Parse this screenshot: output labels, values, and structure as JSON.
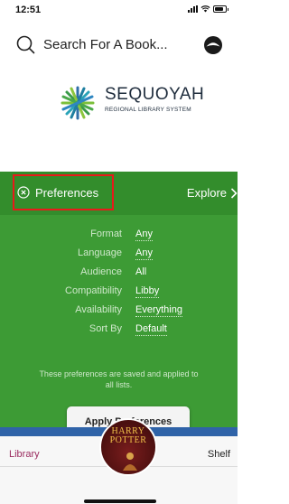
{
  "status_bar": {
    "time": "12:51"
  },
  "search": {
    "label": "Search For A Book..."
  },
  "logo": {
    "title": "SEQUOYAH",
    "subtitle": "REGIONAL LIBRARY SYSTEM"
  },
  "preferences": {
    "button_label": "Preferences",
    "explore_label": "Explore",
    "rows": [
      {
        "label": "Format",
        "value": "Any"
      },
      {
        "label": "Language",
        "value": "Any"
      },
      {
        "label": "Audience",
        "value": "All"
      },
      {
        "label": "Compatibility",
        "value": "Libby"
      },
      {
        "label": "Availability",
        "value": "Everything"
      },
      {
        "label": "Sort By",
        "value": "Default"
      }
    ],
    "note": "These preferences are saved and applied to all lists.",
    "apply_label": "Apply Preferences"
  },
  "bottom_nav": {
    "library_label": "Library",
    "shelf_label": "Shelf"
  },
  "cover": {
    "title_line1": "HARRY",
    "title_line2": "POTTER"
  },
  "colors": {
    "panel": "#3d9b35",
    "header": "#338d2c",
    "highlight": "#e81a1a",
    "library_tab": "#9a2a5e",
    "strip": "#2f63a8"
  }
}
